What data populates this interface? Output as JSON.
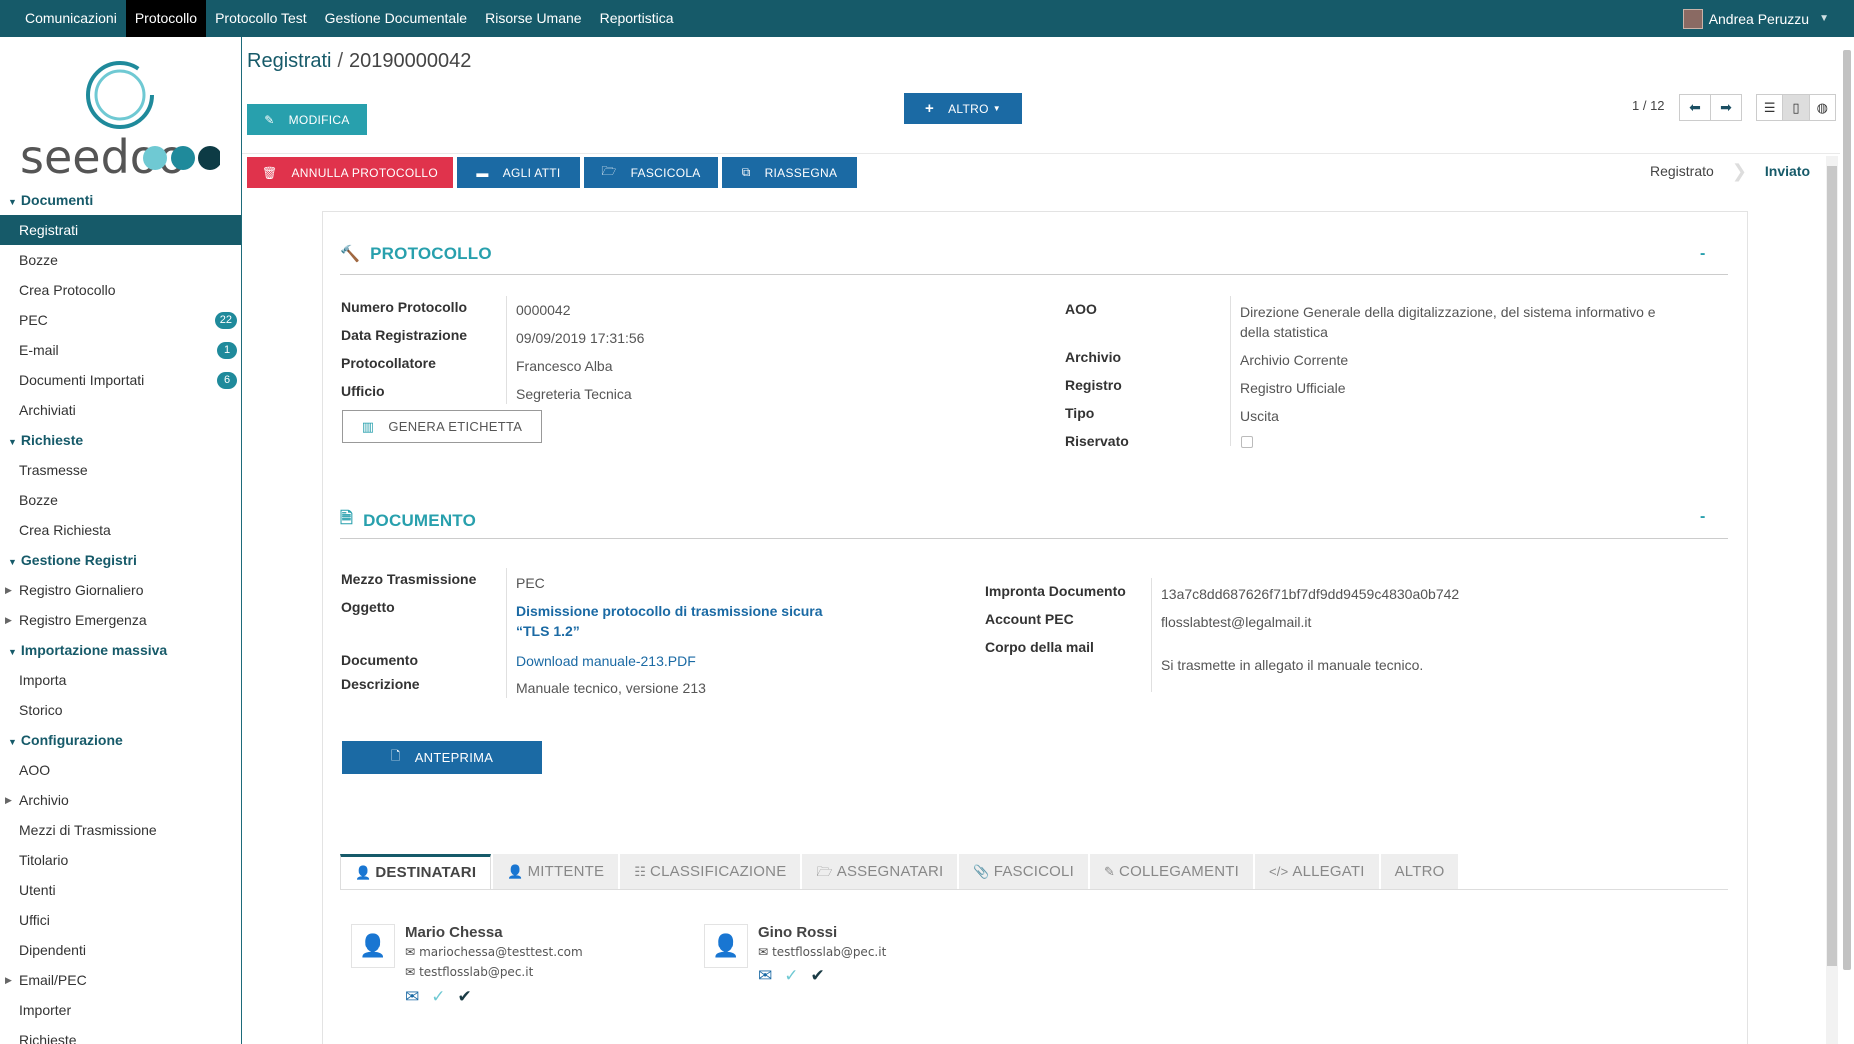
{
  "topbar": {
    "menu": [
      "Comunicazioni",
      "Protocollo",
      "Protocollo Test",
      "Gestione Documentale",
      "Risorse Umane",
      "Reportistica"
    ],
    "active_index": 1,
    "user_name": "Andrea Peruzzu"
  },
  "logo_text": "seedoo",
  "sidebar": {
    "documenti": {
      "title": "Documenti",
      "items": [
        "Registrati",
        "Bozze",
        "Crea Protocollo",
        "PEC",
        "E-mail",
        "Documenti Importati",
        "Archiviati"
      ],
      "badges": {
        "pec": "22",
        "email": "1",
        "importati": "6"
      }
    },
    "richieste": {
      "title": "Richieste",
      "items": [
        "Trasmesse",
        "Bozze",
        "Crea Richiesta"
      ]
    },
    "gestione_registri": {
      "title": "Gestione Registri",
      "items": [
        "Registro Giornaliero",
        "Registro Emergenza"
      ]
    },
    "importazione": {
      "title": "Importazione massiva",
      "items": [
        "Importa",
        "Storico"
      ]
    },
    "configurazione": {
      "title": "Configurazione",
      "items": [
        "AOO",
        "Archivio",
        "Mezzi di Trasmissione",
        "Titolario",
        "Utenti",
        "Uffici",
        "Dipendenti",
        "Email/PEC",
        "Importer",
        "Richieste"
      ]
    }
  },
  "breadcrumb": {
    "parent": "Registrati",
    "separator": "/",
    "current": "20190000042"
  },
  "buttons": {
    "modifica": "MODIFICA",
    "altro": "ALTRO",
    "annulla": "ANNULLA PROTOCOLLO",
    "agli_atti": "AGLI ATTI",
    "fascicola": "FASCICOLA",
    "riassegna": "RIASSEGNA",
    "genera_etichetta": "GENERA ETICHETTA",
    "anteprima": "ANTEPRIMA"
  },
  "pager": {
    "text": "1 / 12"
  },
  "status": {
    "steps": [
      "Registrato",
      "Inviato"
    ],
    "active": "Inviato"
  },
  "protocollo": {
    "title": "PROTOCOLLO",
    "collapse": "-",
    "fields_left": [
      {
        "label": "Numero Protocollo",
        "value": "0000042"
      },
      {
        "label": "Data Registrazione",
        "value": "09/09/2019 17:31:56"
      },
      {
        "label": "Protocollatore",
        "value": "Francesco Alba"
      },
      {
        "label": "Ufficio",
        "value": "Segreteria Tecnica"
      }
    ],
    "aoo_label": "AOO",
    "aoo_value_line1": "Direzione Generale della digitalizzazione, del sistema informativo e",
    "aoo_value_line2": "della statistica",
    "fields_right": [
      {
        "label": "Archivio",
        "value": "Archivio Corrente"
      },
      {
        "label": "Registro",
        "value": "Registro Ufficiale"
      },
      {
        "label": "Tipo",
        "value": "Uscita"
      },
      {
        "label": "Riservato",
        "value": ""
      }
    ]
  },
  "documento": {
    "title": "DOCUMENTO",
    "collapse": "-",
    "mezzo_label": "Mezzo Trasmissione",
    "mezzo_value": "PEC",
    "oggetto_label": "Oggetto",
    "oggetto_line1": "Dismissione protocollo di trasmissione sicura",
    "oggetto_line2": "“TLS 1.2”",
    "documento_label": "Documento",
    "documento_value": "Download manuale-213.PDF",
    "descrizione_label": "Descrizione",
    "descrizione_value": "Manuale tecnico, versione 213",
    "impronta_label": "Impronta Documento",
    "impronta_value": "13a7c8dd687626f71bf7df9dd9459c4830a0b742",
    "account_label": "Account PEC",
    "account_value": "flosslabtest@legalmail.it",
    "corpo_label": "Corpo della mail",
    "corpo_value": "Si trasmette in allegato il manuale tecnico."
  },
  "tabs": [
    "DESTINATARI",
    "MITTENTE",
    "CLASSIFICAZIONE",
    "ASSEGNATARI",
    "FASCICOLI",
    "COLLEGAMENTI",
    "ALLEGATI",
    "ALTRO"
  ],
  "contacts": [
    {
      "name": "Mario Chessa",
      "emails": [
        "mariochessa@testtest.com",
        "testflosslab@pec.it"
      ]
    },
    {
      "name": "Gino Rossi",
      "emails": [
        "testflosslab@pec.it"
      ]
    }
  ],
  "colors": {
    "primary": "#165a69",
    "accent": "#28a0ad",
    "blue": "#1b6aa4",
    "danger": "#e0334c"
  }
}
